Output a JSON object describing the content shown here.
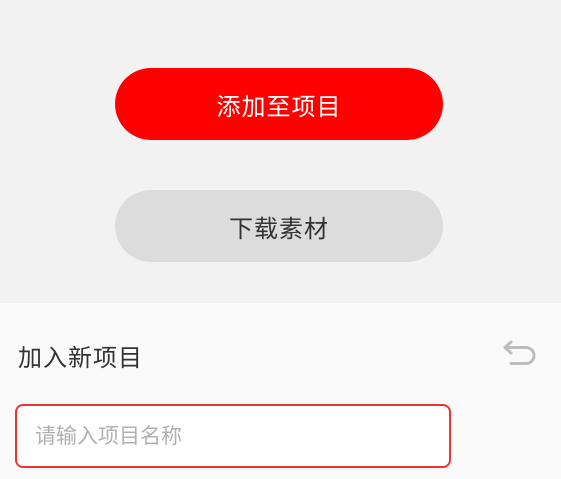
{
  "actions": {
    "add_to_project_label": "添加至项目",
    "download_label": "下载素材"
  },
  "new_project": {
    "title": "加入新项目",
    "back_icon": "undo-icon",
    "input_value": "",
    "input_placeholder": "请输入项目名称"
  },
  "colors": {
    "primary": "#ff0000",
    "secondary": "#dcdcdc",
    "input_border": "#ee3333"
  }
}
